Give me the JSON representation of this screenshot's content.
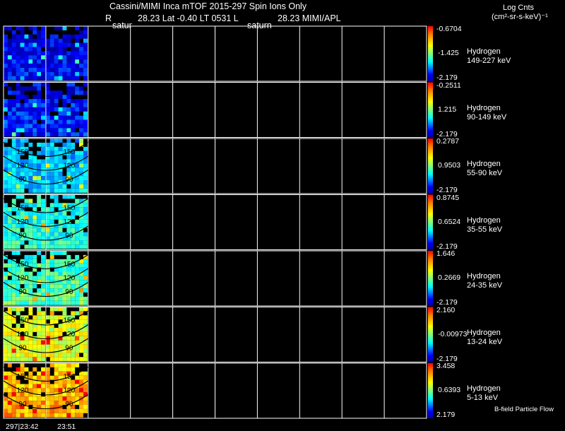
{
  "header": {
    "title": "Cassini/MIMI Inca mTOF  2015-297   Spin   Ions Only",
    "r_label": "R",
    "r_value": "28.23 Lat -0.40 LT 0531 L",
    "l_value": "28.23  MIMI/APL",
    "sub_left": "satur",
    "sub_right": "saturn",
    "units_line1": "Log Cnts",
    "units_line2": "(cm²-sr-s-keV)⁻¹"
  },
  "footer": {
    "time_left": "297|23:42",
    "time_right": "23:51",
    "bfield_label": "B-field Particle Flow"
  },
  "chart_data": {
    "type": "heatmap",
    "columns_total": 10,
    "columns_filled": 2,
    "panels": [
      {
        "species": "Hydrogen",
        "energy": "149-227 keV",
        "cbar_max": "-0.6704",
        "cbar_mid": "-1.425",
        "cbar_min": "-2.179",
        "level": 0.08,
        "contour_labels": []
      },
      {
        "species": "Hydrogen",
        "energy": "90-149 keV",
        "cbar_max": "-0.2511",
        "cbar_mid": "1.215",
        "cbar_min": "-2.179",
        "level": 0.12,
        "contour_labels": []
      },
      {
        "species": "Hydrogen",
        "energy": "55-90 keV",
        "cbar_max": "0.2787",
        "cbar_mid": "0.9503",
        "cbar_min": "-2.179",
        "level": 0.32,
        "contour_labels": [
          "150",
          "120",
          "90"
        ]
      },
      {
        "species": "Hydrogen",
        "energy": "35-55 keV",
        "cbar_max": "0.8745",
        "cbar_mid": "0.6524",
        "cbar_min": "-2.179",
        "level": 0.42,
        "contour_labels": [
          "150",
          "120",
          "90"
        ]
      },
      {
        "species": "Hydrogen",
        "energy": "24-35 keV",
        "cbar_max": "1.646",
        "cbar_mid": "0.2669",
        "cbar_min": "-2.179",
        "level": 0.48,
        "contour_labels": [
          "150",
          "120",
          "90"
        ]
      },
      {
        "species": "Hydrogen",
        "energy": "13-24 keV",
        "cbar_max": "2.160",
        "cbar_mid": "-0.00973",
        "cbar_min": "-2.179",
        "level": 0.66,
        "contour_labels": [
          "150",
          "120",
          "90"
        ]
      },
      {
        "species": "Hydrogen",
        "energy": "5-13 keV",
        "cbar_max": "3.458",
        "cbar_mid": "0.6393",
        "cbar_min": "2.179",
        "level": 0.78,
        "contour_labels": [
          "150",
          "120",
          "90"
        ]
      }
    ],
    "colormap": [
      "#0000a0",
      "#0000ff",
      "#00a0ff",
      "#00ffff",
      "#80ff80",
      "#ffff00",
      "#ffa000",
      "#ff0000"
    ],
    "grid": true
  }
}
